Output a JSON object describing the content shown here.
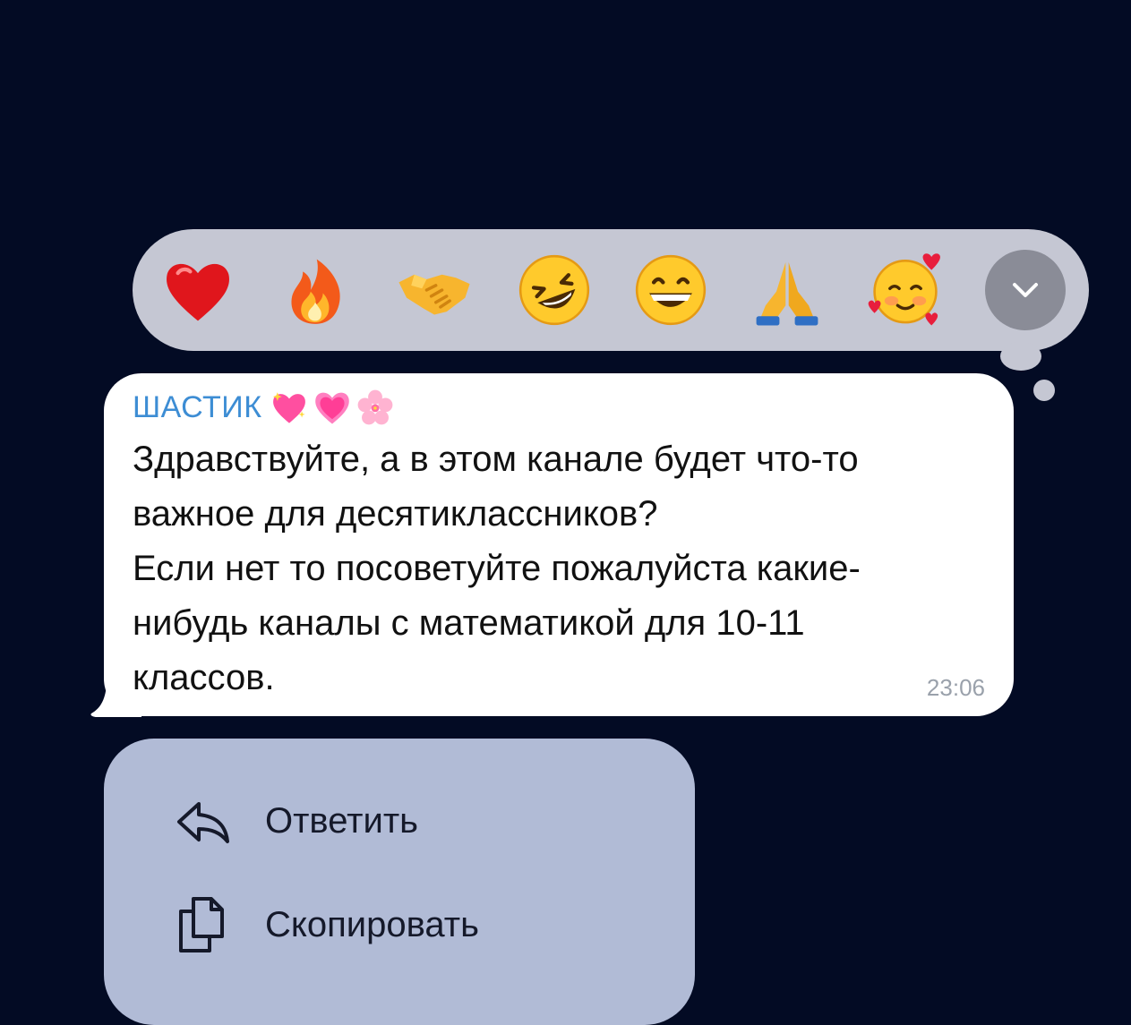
{
  "reactions": [
    {
      "name": "red-heart-icon"
    },
    {
      "name": "fire-icon"
    },
    {
      "name": "handshake-icon"
    },
    {
      "name": "rolling-laughing-icon"
    },
    {
      "name": "grinning-face-icon"
    },
    {
      "name": "folded-hands-icon"
    },
    {
      "name": "smiling-hearts-icon"
    }
  ],
  "expand_icon": "chevron-down-icon",
  "message": {
    "sender": "ШАСТИК",
    "sender_emoji": [
      "sparkling-heart-icon",
      "growing-heart-icon",
      "cherry-blossom-icon"
    ],
    "text": "Здравствуйте, а в этом канале будет что-то\nважное для десятиклассников?\nЕсли нет то посоветуйте пожалуйста какие-\nнибудь каналы с математикой для 10-11\nклассов.",
    "time": "23:06"
  },
  "context_menu": {
    "items": [
      {
        "label": "Ответить",
        "icon": "reply-icon"
      },
      {
        "label": "Скопировать",
        "icon": "copy-icon"
      }
    ]
  },
  "colors": {
    "background": "#030b24",
    "reaction_bar": "#c5c7d3",
    "bubble": "#ffffff",
    "sender": "#3d8dd4",
    "menu": "#b1bbd6"
  }
}
